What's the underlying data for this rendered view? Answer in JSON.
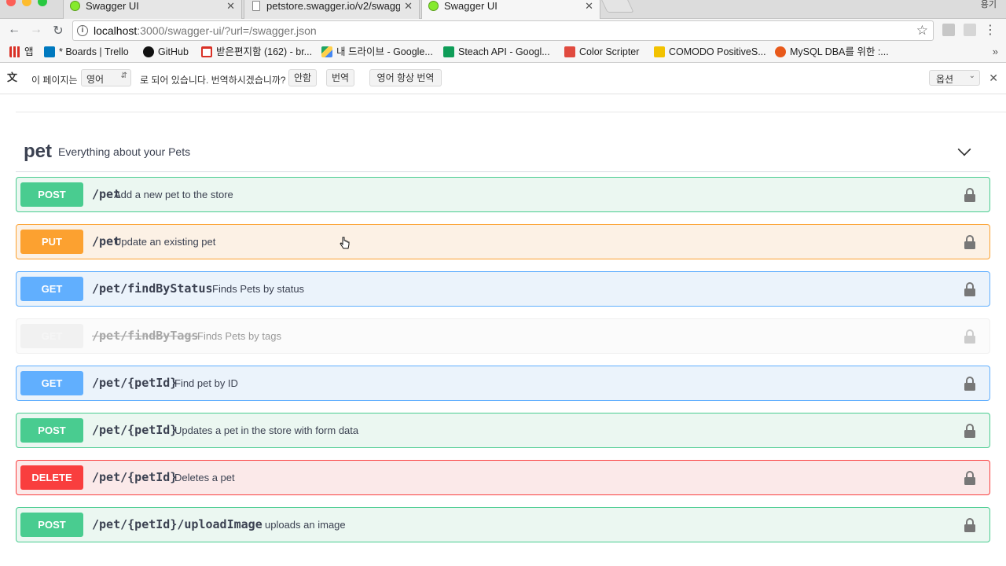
{
  "browser": {
    "tabs": [
      {
        "title": "Swagger UI",
        "icon": "swagger-favicon",
        "active": false
      },
      {
        "title": "petstore.swagger.io/v2/swagg",
        "icon": "document-favicon",
        "active": false
      },
      {
        "title": "Swagger UI",
        "icon": "swagger-favicon",
        "active": true
      }
    ],
    "close_glyph": "✕",
    "profile_label": "용기",
    "url_host": "localhost",
    "url_rest": ":3000/swagger-ui/?url=/swagger.json",
    "bookmarks": [
      {
        "label": "앱",
        "icon": "apps-grid-icon",
        "color": "#d93025"
      },
      {
        "label": "* Boards | Trello",
        "icon": "trello-icon",
        "color": "#0079bf"
      },
      {
        "label": "GitHub",
        "icon": "github-icon",
        "color": "#111111"
      },
      {
        "label": "받은편지함 (162) - br...",
        "icon": "gmail-icon",
        "color": "#d93025"
      },
      {
        "label": "내 드라이브 - Google...",
        "icon": "google-drive-icon",
        "color": "#1fa463"
      },
      {
        "label": "Steach API - Googl...",
        "icon": "google-sheets-icon",
        "color": "#0f9d58"
      },
      {
        "label": "Color Scripter",
        "icon": "color-scripter-icon",
        "color": "#e04a3f"
      },
      {
        "label": "COMODO PositiveS...",
        "icon": "comodo-icon",
        "color": "#f2c200"
      },
      {
        "label": "MySQL DBA를 위한 :...",
        "icon": "mysql-icon",
        "color": "#e8591a"
      }
    ],
    "bookmarks_more": "»"
  },
  "translate_bar": {
    "prefix": "이 페이지는",
    "language": "영어",
    "middle": "로 되어 있습니다. 번역하시겠습니까?",
    "no_button": "안함",
    "translate_button": "번역",
    "always_button": "영어 항상 번역",
    "options": "옵션"
  },
  "swagger": {
    "tag": {
      "name": "pet",
      "description": "Everything about your Pets"
    },
    "operations": [
      {
        "method": "POST",
        "path": "/pet",
        "summary": "Add a new pet to the store",
        "kind": "post",
        "deprecated": false
      },
      {
        "method": "PUT",
        "path": "/pet",
        "summary": "Update an existing pet",
        "kind": "put",
        "deprecated": false
      },
      {
        "method": "GET",
        "path": "/pet/findByStatus",
        "summary": "Finds Pets by status",
        "kind": "get",
        "deprecated": false
      },
      {
        "method": "GET",
        "path": "/pet/findByTags",
        "summary": "Finds Pets by tags",
        "kind": "deprecated",
        "deprecated": true
      },
      {
        "method": "GET",
        "path": "/pet/{petId}",
        "summary": "Find pet by ID",
        "kind": "get",
        "deprecated": false
      },
      {
        "method": "POST",
        "path": "/pet/{petId}",
        "summary": "Updates a pet in the store with form data",
        "kind": "post",
        "deprecated": false
      },
      {
        "method": "DELETE",
        "path": "/pet/{petId}",
        "summary": "Deletes a pet",
        "kind": "delete",
        "deprecated": false
      },
      {
        "method": "POST",
        "path": "/pet/{petId}/uploadImage",
        "summary": "uploads an image",
        "kind": "post",
        "deprecated": false
      }
    ]
  },
  "colors": {
    "post": "#49cc90",
    "put": "#fca130",
    "get": "#61affe",
    "delete": "#f93e3e"
  }
}
